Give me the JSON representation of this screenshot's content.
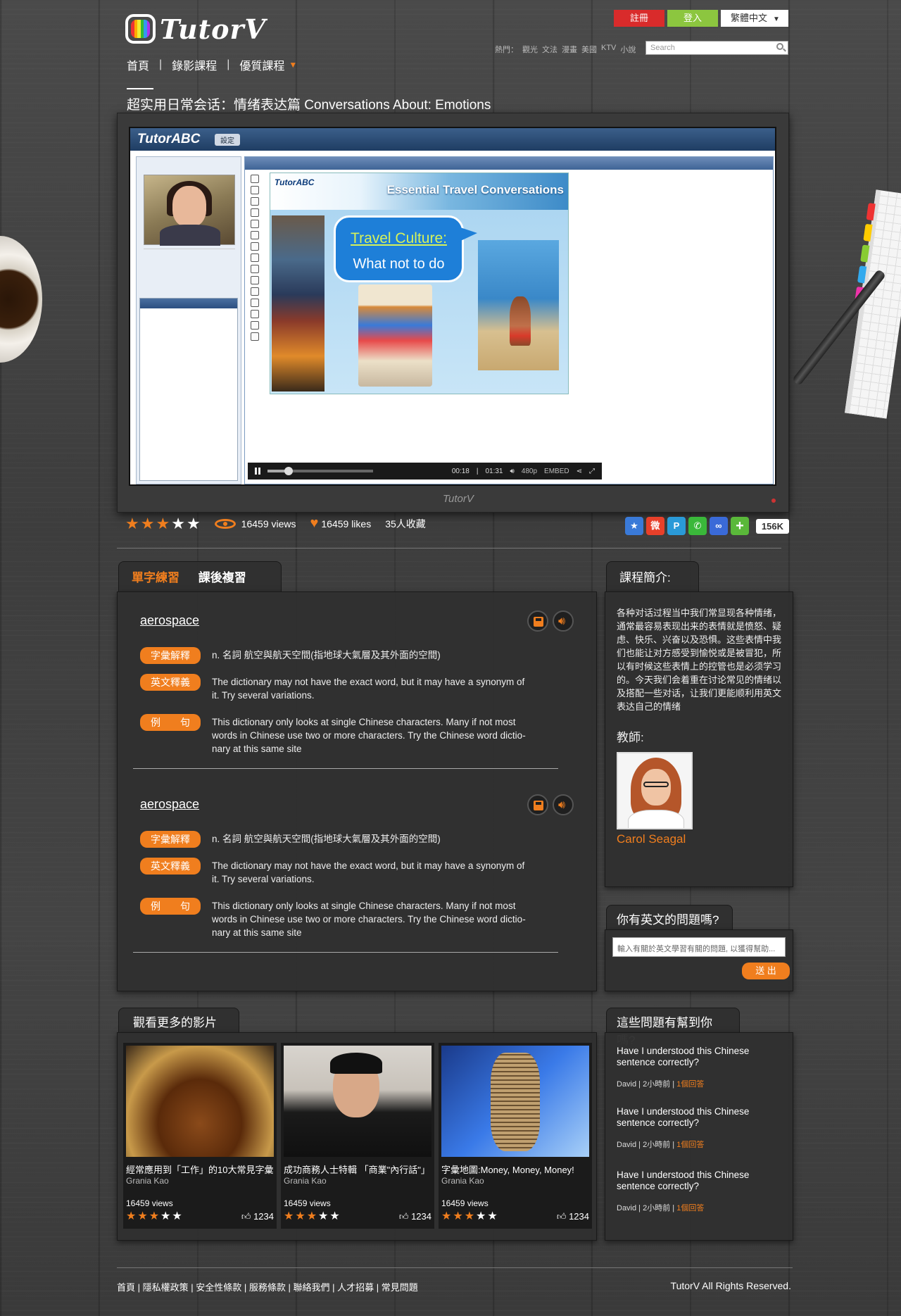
{
  "header": {
    "logo_text": "TutorV",
    "nav": [
      {
        "label": "首頁"
      },
      {
        "label": "錄影課程"
      },
      {
        "label": "優質課程"
      }
    ],
    "register_label": "註冊",
    "login_label": "登入",
    "language_label": "繁體中文",
    "hot_label": "熱門：",
    "hot_tags": [
      "觀光",
      "文法",
      "漫畫",
      "美國",
      "KTV",
      "小說"
    ],
    "search_placeholder": "Search"
  },
  "page_title": "超实用日常会话：情绪表达篇 Conversations About: Emotions",
  "player": {
    "app_brand": "TutorABC",
    "settings_label": "設定",
    "slide_title": "Essential Travel Conversations",
    "slide_bubble_line1": "Travel Culture:",
    "slide_bubble_line2": "What not to do",
    "time_current": "00:18",
    "time_total": "01:31",
    "progress": 0.2,
    "quality": "480p",
    "embed_label": "EMBED",
    "frame_brand": "TutorV"
  },
  "stats": {
    "rating": 3,
    "rating_max": 5,
    "views": "16459 views",
    "likes": "16459 likes",
    "favorites": "35人收藏",
    "share_count": "156K"
  },
  "vocab": {
    "tab_active": "單字練習",
    "tab_inactive": "課後複習",
    "entries": [
      {
        "word": "aerospace",
        "pill1": "字彙解釋",
        "def1": "n. 名詞 航空與航天空間(指地球大氣層及其外面的空間)",
        "pill2": "英文釋義",
        "def2": "The dictionary may not have the exact word, but it may have a synonym of it. Try several variations.",
        "pill3": "例　　句",
        "def3": "This dictionary only looks at single Chinese characters. Many if not most words in Chinese use two or more characters. Try the Chinese word dictio- nary at this same site"
      },
      {
        "word": "aerospace",
        "pill1": "字彙解釋",
        "def1": "n. 名詞 航空與航天空間(指地球大氣層及其外面的空間)",
        "pill2": "英文釋義",
        "def2": "The dictionary may not have the exact word, but it may have a synonym of it. Try several variations.",
        "pill3": "例　　句",
        "def3": "This dictionary only looks at single Chinese characters. Many if not most words in Chinese use two or more characters. Try the Chinese word dictio- nary at this same site"
      }
    ]
  },
  "course": {
    "tab_label": "課程簡介:",
    "description": "各种对话过程当中我们常显现各种情绪，通常最容易表现出来的表情就是愤怒、疑虑、快乐、兴奋以及恐惧。这些表情中我们也能让对方感受到愉悦或是被冒犯，所以有时候这些表情上的控管也是必须学习的。今天我们会着重在讨论常见的情绪以及搭配一些对话，让我们更能顺利用英文表达自己的情绪",
    "teacher_label": "教師:",
    "teacher_name": "Carol Seagal"
  },
  "question": {
    "tab_label": "你有英文的問題嗎?",
    "placeholder": "輸入有關於英文學習有關的問題, 以獲得幫助...",
    "submit_label": "送 出"
  },
  "more_videos": {
    "tab_label": "觀看更多的影片",
    "items": [
      {
        "title": "經常應用到「工作」的10大常見字彙",
        "author": "Grania Kao",
        "views": "16459 views",
        "rating": 3,
        "likes": "1234"
      },
      {
        "title": "成功商務人士特輯 「商業\"內行話\"」",
        "author": "Grania Kao",
        "views": "16459 views",
        "rating": 3,
        "likes": "1234"
      },
      {
        "title": "字彙地圖:Money, Money, Money!",
        "author": "Grania Kao",
        "views": "16459 views",
        "rating": 3,
        "likes": "1234"
      }
    ]
  },
  "helpful": {
    "tab_label": "這些問題有幫到你嗎?",
    "items": [
      {
        "question": "Have I understood this Chinese sentence correctly?",
        "user": "David",
        "time": "2小時前",
        "answers": "1個回答"
      },
      {
        "question": "Have I understood this Chinese sentence correctly?",
        "user": "David",
        "time": "2小時前",
        "answers": "1個回答"
      },
      {
        "question": "Have I understood this Chinese sentence correctly?",
        "user": "David",
        "time": "2小時前",
        "answers": "1個回答"
      }
    ]
  },
  "footer": {
    "links": [
      "首頁",
      "隱私權政策",
      "安全性條款",
      "服務條款",
      "聯絡我們",
      "人才招募",
      "常見問題"
    ],
    "copyright": "TutorV All Rights Reserved."
  },
  "colors": {
    "accent": "#f07e1e",
    "register": "#d92b2b",
    "login": "#8cc63f"
  }
}
